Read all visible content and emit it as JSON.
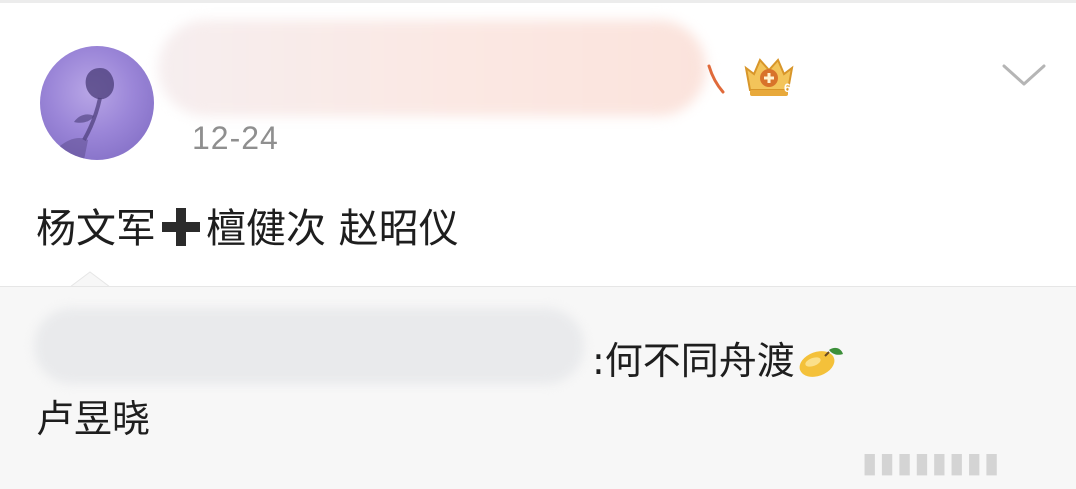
{
  "post": {
    "date": "12-24",
    "text_part1": "杨文军",
    "text_part2": "檀健次 赵昭仪"
  },
  "comment": {
    "reply_text": ":何不同舟渡",
    "reply_text_line2": "卢昱晓"
  },
  "icons": {
    "badge": "crown-badge-icon",
    "chevron": "chevron-down-icon",
    "plus": "heavy-plus-icon",
    "mango": "mango-emoji-icon"
  },
  "colors": {
    "date": "#8f8f8f",
    "comment_bg": "#f7f7f7",
    "badge_gold": "#e8a93b"
  }
}
